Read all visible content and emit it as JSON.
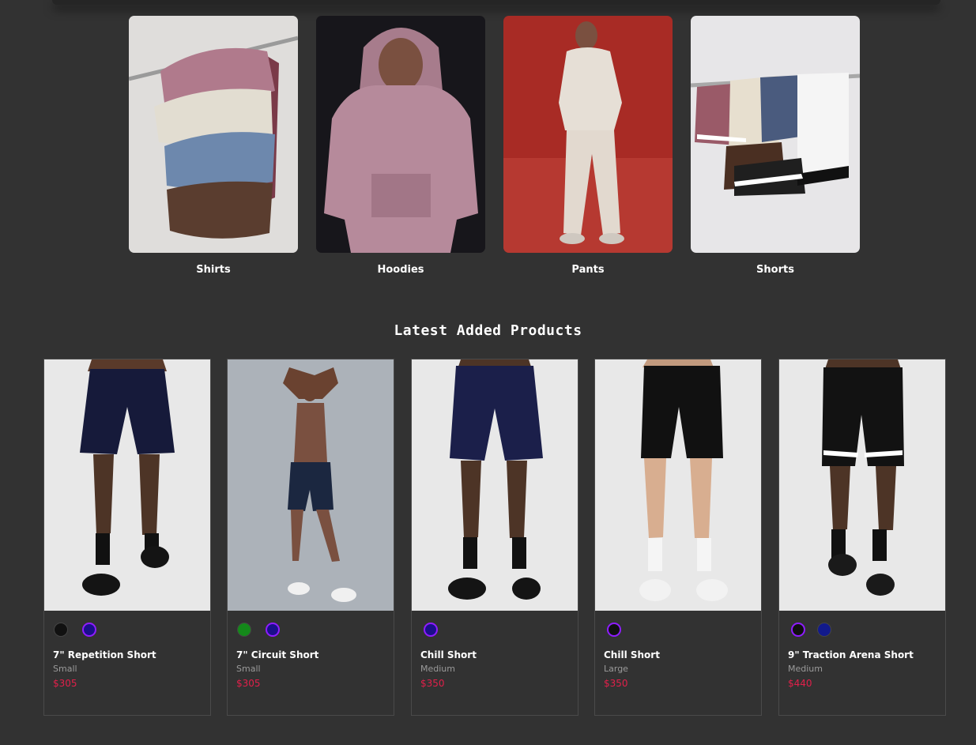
{
  "categories": [
    {
      "label": "Shirts"
    },
    {
      "label": "Hoodies"
    },
    {
      "label": "Pants"
    },
    {
      "label": "Shorts"
    }
  ],
  "section_title": "Latest Added Products",
  "products": [
    {
      "name": "7\" Repetition Short",
      "size": "Small",
      "price": "$305",
      "swatches": [
        "#111111",
        "#1a0f8a"
      ]
    },
    {
      "name": "7\" Circuit Short",
      "size": "Small",
      "price": "$305",
      "swatches": [
        "#14891a",
        "#1a0f8a"
      ]
    },
    {
      "name": "Chill Short",
      "size": "Medium",
      "price": "$350",
      "swatches": [
        "#1a0f8a"
      ]
    },
    {
      "name": "Chill Short",
      "size": "Large",
      "price": "$350",
      "swatches": [
        "#111111"
      ]
    },
    {
      "name": "9\" Traction Arena Short",
      "size": "Medium",
      "price": "$440",
      "swatches": [
        "#111111",
        "#121a8c"
      ]
    }
  ],
  "colors": {
    "background": "#323232",
    "price": "#e0204a",
    "size_text": "#9a9a9a",
    "card_border": "#4a4a4a"
  }
}
